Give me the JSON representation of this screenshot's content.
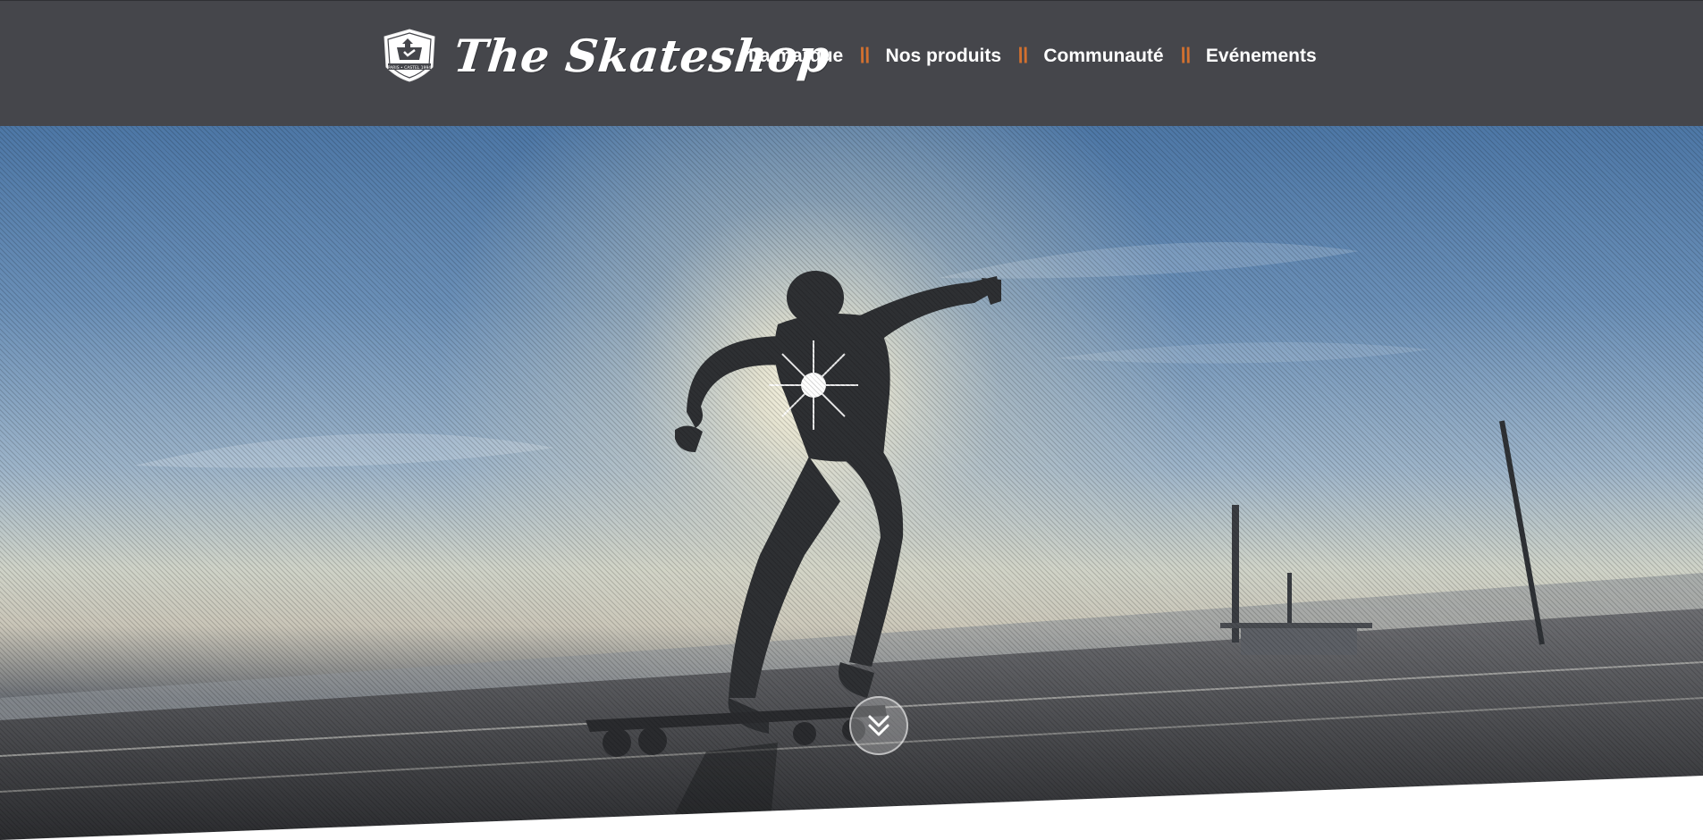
{
  "header": {
    "brand": {
      "name": "The Skateshop",
      "logo_icon": "skateshop-shield-logo-icon",
      "logo_text": "PARIS • CASTEL 1994"
    },
    "nav": [
      {
        "label": "La marque"
      },
      {
        "label": "Nos produits"
      },
      {
        "label": "Communauté"
      },
      {
        "label": "Evénements"
      }
    ],
    "separator": "\\\\"
  },
  "hero": {
    "scene": "skateboarder-silhouette-sunset",
    "scroll_icon": "chevron-double-down-icon"
  },
  "colors": {
    "header_bg": "#45464b",
    "accent": "#d2702f",
    "text": "#ffffff"
  }
}
